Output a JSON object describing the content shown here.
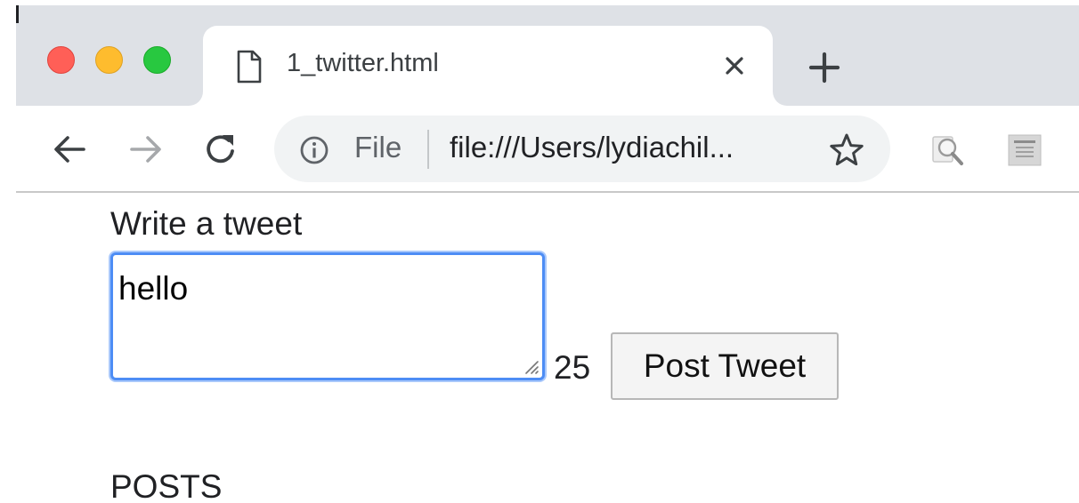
{
  "browser": {
    "tab_title": "1_twitter.html",
    "omnibox": {
      "scheme_label": "File",
      "url": "file:///Users/lydiachil..."
    },
    "icons": {
      "tab": "file-icon",
      "close": "close-icon",
      "new_tab": "plus-icon",
      "back": "back-arrow-icon",
      "forward": "forward-arrow-icon",
      "reload": "reload-icon",
      "info": "info-icon",
      "bookmark": "star-icon",
      "extension_1": "magnifier-extension-icon",
      "extension_2": "bigger-notes-extension-icon"
    },
    "colors": {
      "tabstrip": "#dee1e6",
      "omnibox": "#f1f3f4",
      "focus_ring": "#4d8df5",
      "close_dot": "#ff5f57",
      "minimize_dot": "#febc2e",
      "zoom_dot": "#28c840"
    }
  },
  "page": {
    "compose_label": "Write a tweet",
    "tweet_text": "hello",
    "char_count": "25",
    "post_button": "Post Tweet",
    "posts_heading": "POSTS"
  }
}
